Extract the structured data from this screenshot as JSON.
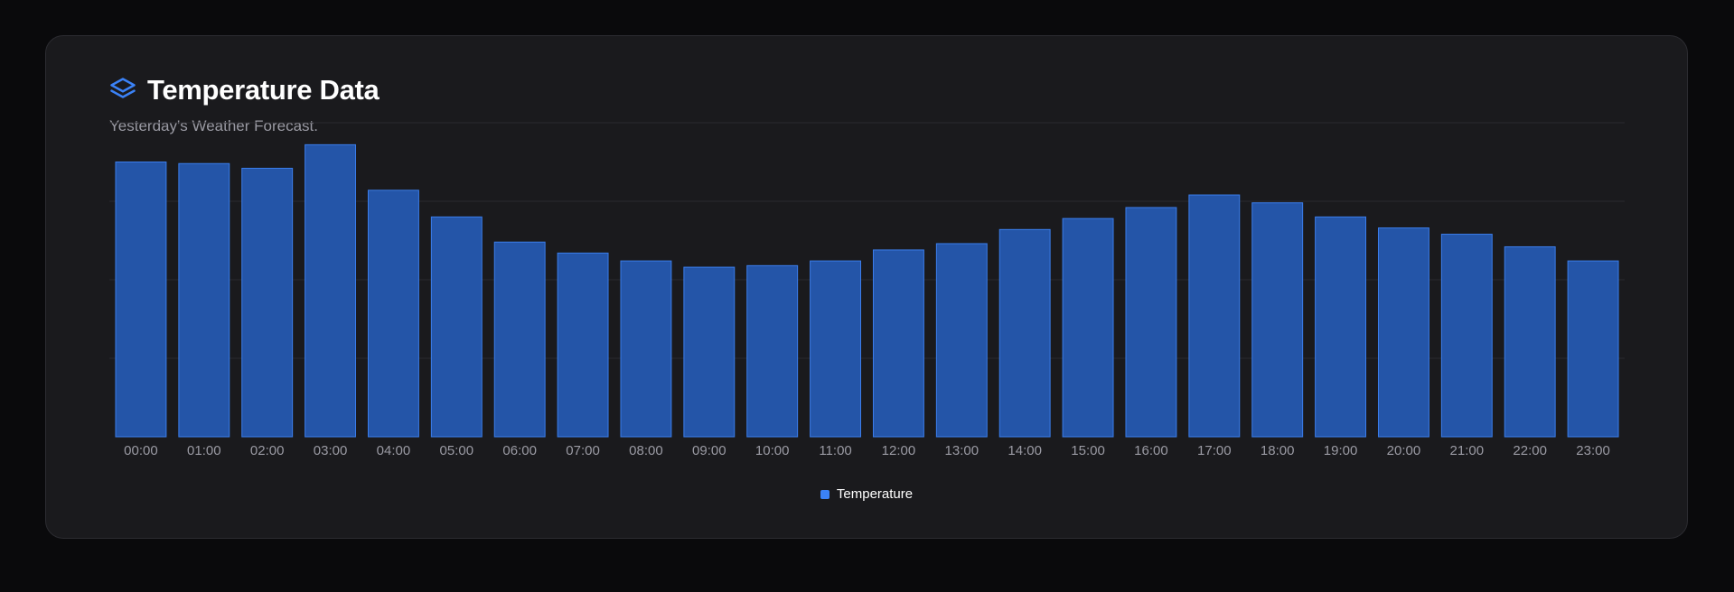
{
  "header": {
    "icon": "layers-icon",
    "title": "Temperature Data",
    "subtitle": "Yesterday's Weather Forecast."
  },
  "colors": {
    "background": "#0a0a0c",
    "card": "#1a1a1d",
    "accent": "#3b82f6",
    "bar_fill": "#2455a8",
    "bar_stroke": "#3b7dea",
    "grid": "#2a2a2e",
    "tick_text": "#9a9aa3"
  },
  "chart_data": {
    "type": "bar",
    "title": "Temperature Data",
    "subtitle": "Yesterday's Weather Forecast.",
    "categories": [
      "00:00",
      "01:00",
      "02:00",
      "03:00",
      "04:00",
      "05:00",
      "06:00",
      "07:00",
      "08:00",
      "09:00",
      "10:00",
      "11:00",
      "12:00",
      "13:00",
      "14:00",
      "15:00",
      "16:00",
      "17:00",
      "18:00",
      "19:00",
      "20:00",
      "21:00",
      "22:00",
      "23:00"
    ],
    "series": [
      {
        "name": "Temperature",
        "values": [
          17.5,
          17.4,
          17.1,
          18.6,
          15.7,
          14.0,
          12.4,
          11.7,
          11.2,
          10.8,
          10.9,
          11.2,
          11.9,
          12.3,
          13.2,
          13.9,
          14.6,
          15.4,
          14.9,
          14.0,
          13.3,
          12.9,
          12.1,
          11.2
        ]
      }
    ],
    "ylim": [
      0,
      20
    ],
    "y_grid_step": 5,
    "y_axis_visible": false,
    "grid": true,
    "legend": "bottom-center"
  }
}
